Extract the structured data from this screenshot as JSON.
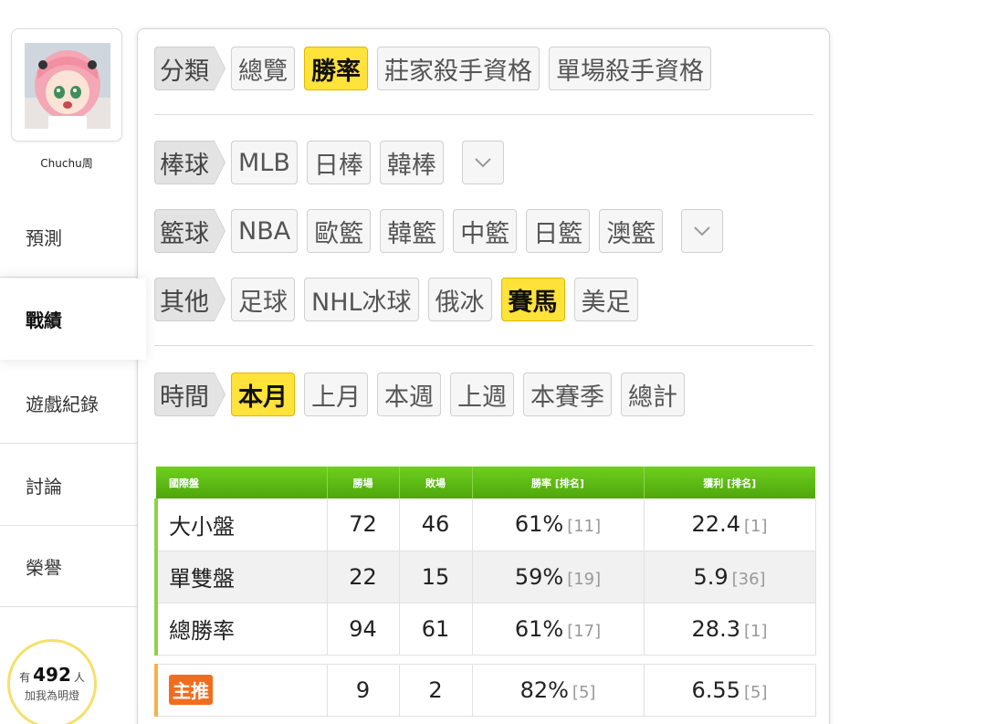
{
  "profile": {
    "username": "Chuchu周"
  },
  "nav": [
    {
      "label": "預測"
    },
    {
      "label": "戰績"
    },
    {
      "label": "遊戲紀錄"
    },
    {
      "label": "討論"
    },
    {
      "label": "榮譽"
    }
  ],
  "fans": {
    "prefix": "有",
    "count": "492",
    "suffix": "人",
    "caption": "加我為明燈"
  },
  "filters": {
    "category": {
      "label": "分類",
      "options": [
        "總覽",
        "勝率",
        "莊家殺手資格",
        "單場殺手資格"
      ],
      "selected": "勝率"
    },
    "baseball": {
      "label": "棒球",
      "options": [
        "MLB",
        "日棒",
        "韓棒"
      ]
    },
    "basketball": {
      "label": "籃球",
      "options": [
        "NBA",
        "歐籃",
        "韓籃",
        "中籃",
        "日籃",
        "澳籃"
      ]
    },
    "other": {
      "label": "其他",
      "options": [
        "足球",
        "NHL冰球",
        "俄冰",
        "賽馬",
        "美足"
      ],
      "selected": "賽馬"
    },
    "time": {
      "label": "時間",
      "options": [
        "本月",
        "上月",
        "本週",
        "上週",
        "本賽季",
        "總計"
      ],
      "selected": "本月"
    }
  },
  "table": {
    "headers": [
      "國際盤",
      "勝場",
      "敗場",
      "勝率 [排名]",
      "獲利 [排名]"
    ],
    "rows": [
      {
        "name": "大小盤",
        "win": "72",
        "lose": "46",
        "rate": "61%",
        "rate_rank": "[11]",
        "profit": "22.4",
        "profit_rank": "[1]"
      },
      {
        "name": "單雙盤",
        "win": "22",
        "lose": "15",
        "rate": "59%",
        "rate_rank": "[19]",
        "profit": "5.9",
        "profit_rank": "[36]"
      },
      {
        "name": "總勝率",
        "win": "94",
        "lose": "61",
        "rate": "61%",
        "rate_rank": "[17]",
        "profit": "28.3",
        "profit_rank": "[1]"
      }
    ],
    "main_pick": {
      "badge": "主推",
      "win": "9",
      "lose": "2",
      "rate": "82%",
      "rate_rank": "[5]",
      "profit": "6.55",
      "profit_rank": "[5]"
    }
  },
  "colors": {
    "active_chip": "#ffe23a",
    "table_header": "#5cbc14",
    "main_badge": "#f06d1e"
  }
}
